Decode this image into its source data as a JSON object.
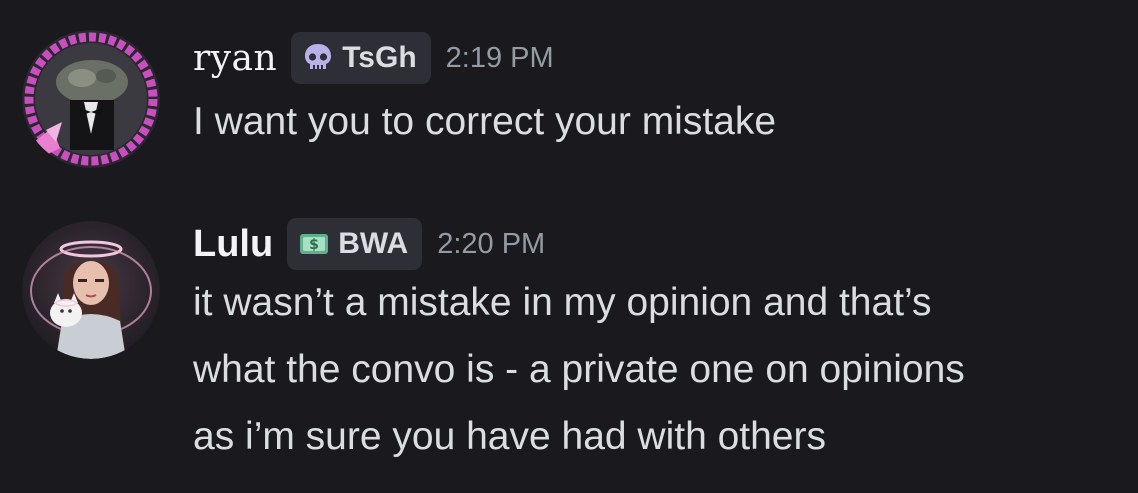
{
  "messages": [
    {
      "username": "ryan",
      "tag": {
        "icon": "skull-icon",
        "text": "TsGh"
      },
      "timestamp": "2:19 PM",
      "lines": [
        "I want you to correct your mistake"
      ],
      "avatar": "avatar-ryan"
    },
    {
      "username": "Lulu",
      "tag": {
        "icon": "money-icon",
        "text": "BWA"
      },
      "timestamp": "2:20 PM",
      "lines": [
        "it wasn’t a mistake in my opinion and that’s",
        "what the convo is - a private one on opinions",
        "as i’m sure you have had with others"
      ],
      "avatar": "avatar-lulu"
    }
  ],
  "colors": {
    "background": "#1a1a1e",
    "text": "#dbdee1",
    "username": "#f2f3f5",
    "timestamp": "#949ba4",
    "tag_bg": "#2e2f36",
    "avatar_ring_ryan": "#c94fc0",
    "avatar_glow_lulu": "#e8a6c9"
  }
}
